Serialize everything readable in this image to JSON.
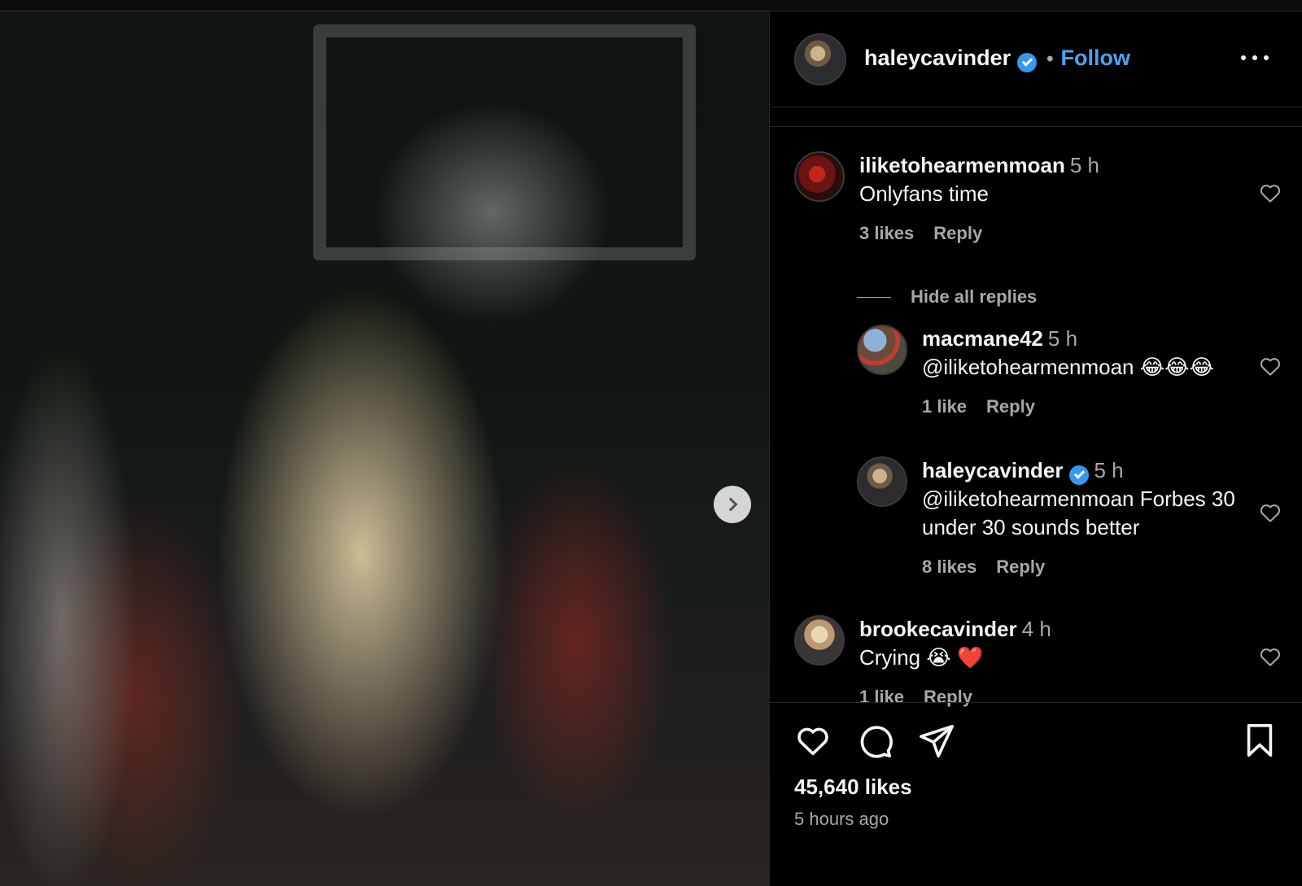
{
  "post": {
    "author": "haleycavinder",
    "follow_label": "Follow",
    "separator": "•",
    "likes": "45,640 likes",
    "posted": "5 hours ago"
  },
  "comments": [
    {
      "user": "iliketohearmenmoan",
      "time": "5 h",
      "text": "Onlyfans time",
      "likes": "3 likes",
      "reply_label": "Reply"
    }
  ],
  "replies_toggle": "Hide all replies",
  "replies": [
    {
      "user": "macmane42",
      "time": "5 h",
      "text": "@iliketohearmenmoan 😂😂😂",
      "likes": "1 like",
      "reply_label": "Reply"
    },
    {
      "user": "haleycavinder",
      "time": "5 h",
      "text": "@iliketohearmenmoan Forbes 30 under 30 sounds better",
      "likes": "8 likes",
      "reply_label": "Reply"
    }
  ],
  "more_comments": [
    {
      "user": "brookecavinder",
      "time": "4 h",
      "text": "Crying 😭 ❤️",
      "likes": "1 like",
      "reply_label": "Reply"
    }
  ],
  "icons": {
    "like": "heart-icon",
    "comment": "comment-icon",
    "share": "send-icon",
    "save": "bookmark-icon",
    "more": "more-options-icon",
    "next": "chevron-right-icon",
    "verified": "verified-badge-icon"
  },
  "colors": {
    "accent": "#4aa3f5",
    "verified": "#3897f0",
    "muted": "#a8a8a8",
    "background": "#000000"
  }
}
